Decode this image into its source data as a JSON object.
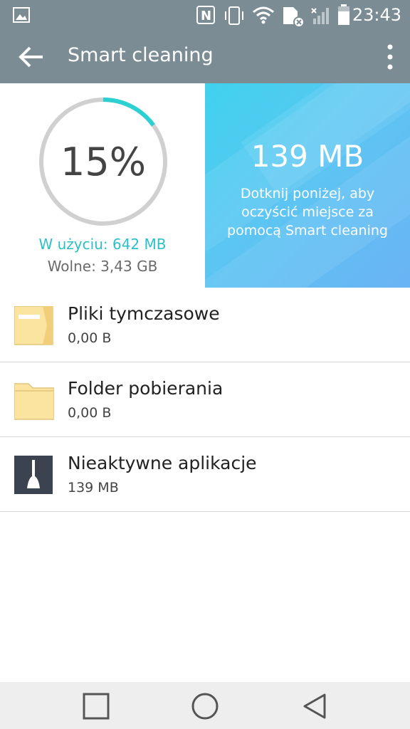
{
  "status_bar": {
    "time": "23:43",
    "icons": [
      "gallery-icon",
      "nfc-icon",
      "vibrate-icon",
      "wifi-icon",
      "sim-icon",
      "signal-icon",
      "battery-icon"
    ]
  },
  "app_bar": {
    "title": "Smart cleaning",
    "back_icon": "arrow-left-icon",
    "menu_icon": "more-vert-icon"
  },
  "storage": {
    "percent_label": "15%",
    "percent_value": 15,
    "used": "W użyciu: 642  MB",
    "free": "Wolne: 3,43  GB",
    "accent_color": "#2bbfc9"
  },
  "clean_card": {
    "size": "139  MB",
    "hint": "Dotknij poniżej, aby oczyścić miejsce za pomocą Smart cleaning"
  },
  "items": [
    {
      "name": "Pliki tymczasowe",
      "size": "0,00  B",
      "icon": "temp-folder-icon"
    },
    {
      "name": "Folder pobierania",
      "size": "0,00  B",
      "icon": "folder-icon"
    },
    {
      "name": "Nieaktywne aplikacje",
      "size": "139  MB",
      "icon": "broom-icon"
    }
  ],
  "nav_bar": {
    "icons": [
      "recents-icon",
      "home-icon",
      "back-icon"
    ]
  }
}
